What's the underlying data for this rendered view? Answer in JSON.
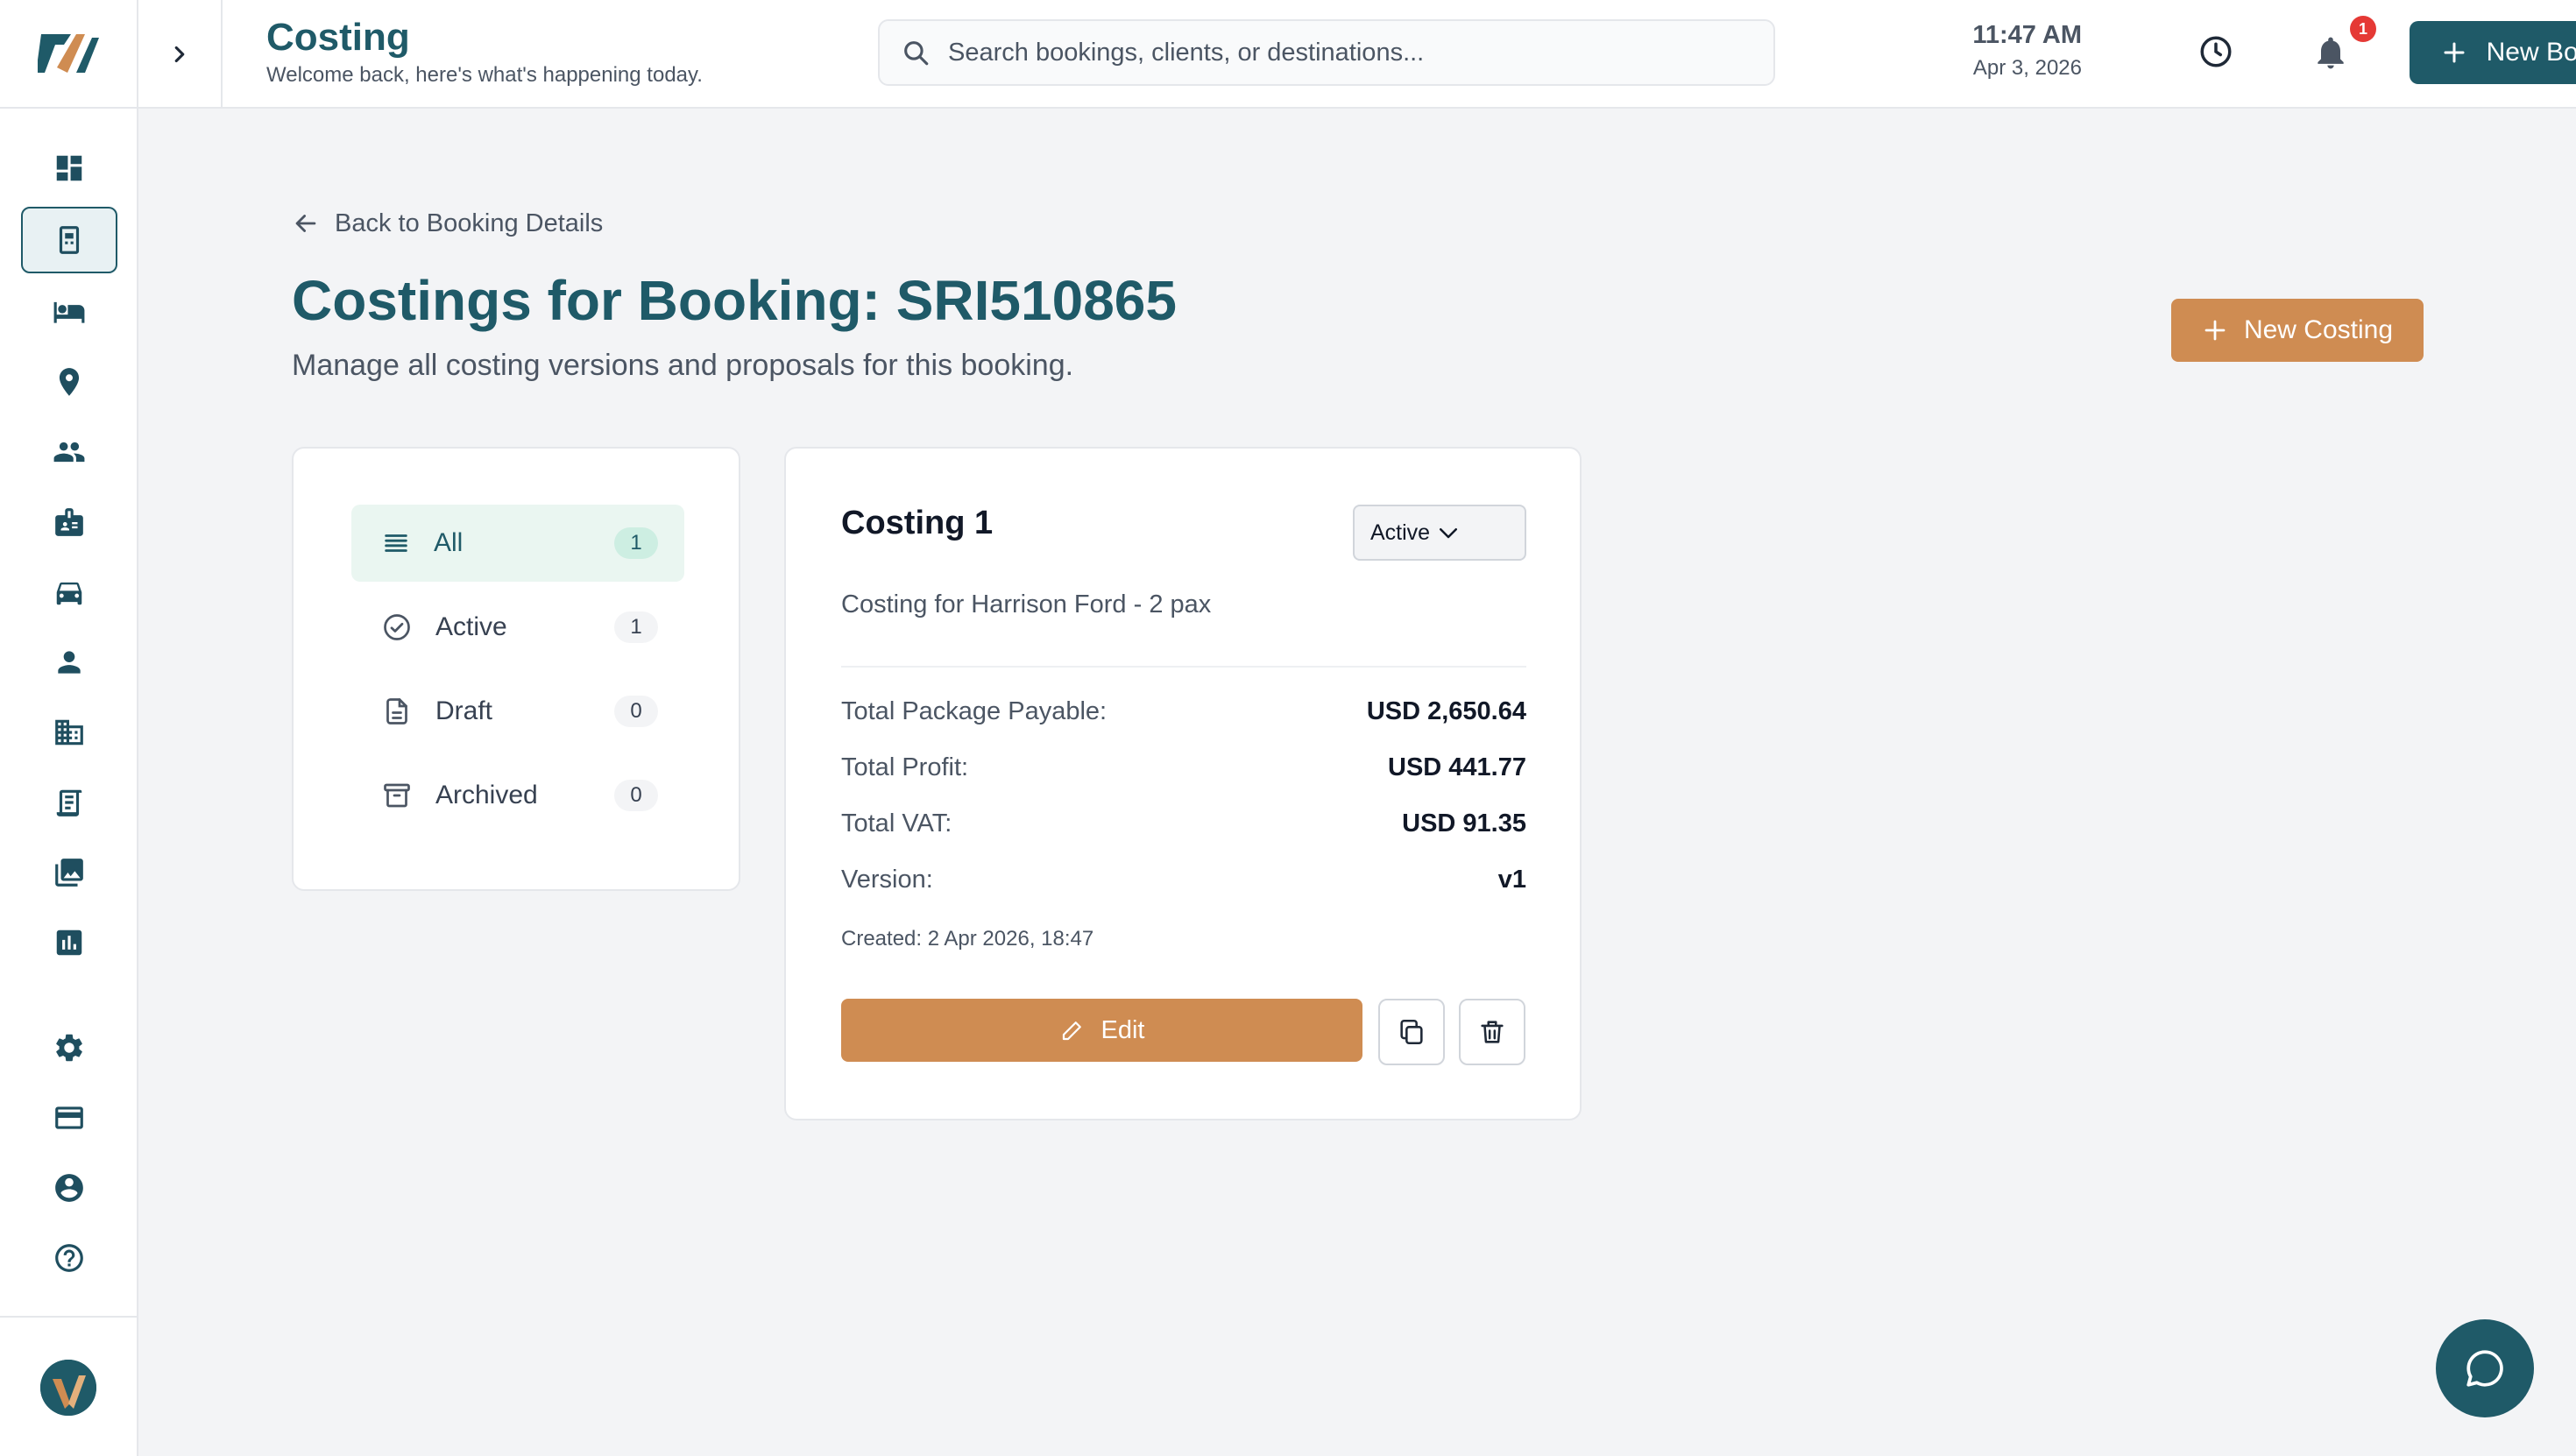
{
  "header": {
    "title": "Costing",
    "subtitle": "Welcome back, here's what's happening today.",
    "search_placeholder": "Search bookings, clients, or destinations...",
    "time": "11:47 AM",
    "date": "Apr 3, 2026",
    "notification_count": "1",
    "new_booking_label": "New Booking"
  },
  "sidebar": {
    "items": [
      {
        "name": "dashboard",
        "icon": "grid-icon"
      },
      {
        "name": "costing",
        "icon": "calculator-icon",
        "active": true
      },
      {
        "name": "hotels",
        "icon": "bed-icon"
      },
      {
        "name": "destinations",
        "icon": "location-pin-icon"
      },
      {
        "name": "clients",
        "icon": "people-icon"
      },
      {
        "name": "staff",
        "icon": "badge-icon"
      },
      {
        "name": "vehicles",
        "icon": "car-icon"
      },
      {
        "name": "users",
        "icon": "person-icon"
      },
      {
        "name": "companies",
        "icon": "building-icon"
      },
      {
        "name": "invoices",
        "icon": "receipt-icon"
      },
      {
        "name": "gallery",
        "icon": "photos-icon"
      },
      {
        "name": "reports",
        "icon": "bar-chart-icon"
      },
      {
        "name": "settings",
        "icon": "gear-icon"
      },
      {
        "name": "billing",
        "icon": "credit-card-icon"
      },
      {
        "name": "account",
        "icon": "account-circle-icon"
      },
      {
        "name": "help",
        "icon": "help-circle-icon"
      }
    ]
  },
  "page": {
    "back_label": "Back to Booking Details",
    "title": "Costings for Booking: SRI510865",
    "description": "Manage all costing versions and proposals for this booking.",
    "new_costing_label": "New Costing"
  },
  "filters": [
    {
      "label": "All",
      "count": "1",
      "selected": true
    },
    {
      "label": "Active",
      "count": "1"
    },
    {
      "label": "Draft",
      "count": "0"
    },
    {
      "label": "Archived",
      "count": "0"
    }
  ],
  "costing": {
    "title": "Costing 1",
    "status": "Active",
    "description": "Costing for Harrison Ford - 2 pax",
    "rows": [
      {
        "key": "Total Package Payable:",
        "value": "USD 2,650.64"
      },
      {
        "key": "Total Profit:",
        "value": "USD 441.77"
      },
      {
        "key": "Total VAT:",
        "value": "USD 91.35"
      },
      {
        "key": "Version:",
        "value": "v1"
      }
    ],
    "created": "Created: 2 Apr 2026, 18:47",
    "edit_label": "Edit"
  },
  "colors": {
    "primary": "#1f5a68",
    "accent": "#cf8c52",
    "badge_red": "#e53935"
  }
}
